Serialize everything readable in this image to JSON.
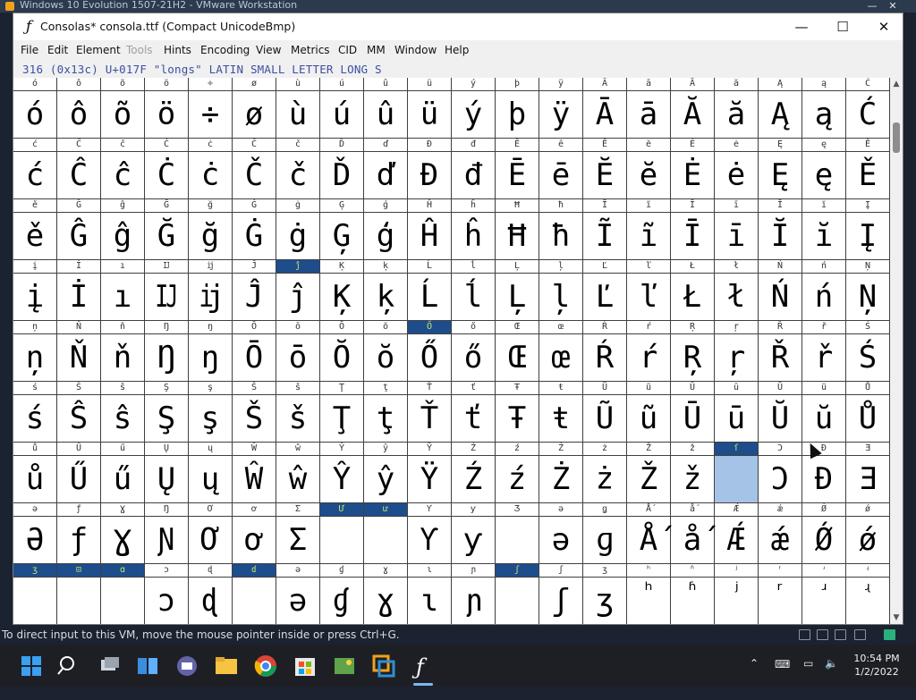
{
  "vm_window": {
    "title": "Windows 10 Evolution 1507-21H2 - VMware Workstation",
    "minimize": "—",
    "close": "✕"
  },
  "app": {
    "title": "Consolas* consola.ttf (Compact UnicodeBmp)",
    "icon": "fontforge-icon",
    "minimize": "—",
    "maximize": "☐",
    "close": "✕"
  },
  "menu": [
    {
      "label": "File",
      "enabled": true
    },
    {
      "label": "Edit",
      "enabled": true
    },
    {
      "label": "Element",
      "enabled": true
    },
    {
      "label": "Tools",
      "enabled": false
    },
    {
      "label": "Hints",
      "enabled": true
    },
    {
      "label": "Encoding",
      "enabled": true
    },
    {
      "label": "View",
      "enabled": true
    },
    {
      "label": "Metrics",
      "enabled": true
    },
    {
      "label": "CID",
      "enabled": true
    },
    {
      "label": "MM",
      "enabled": true
    },
    {
      "label": "Window",
      "enabled": true
    },
    {
      "label": "Help",
      "enabled": true
    }
  ],
  "info_line": "316 (0x13c) U+017F \"longs\" LATIN SMALL LETTER LONG S",
  "colors": {
    "highlight_label": "#1e4d8c",
    "highlight_text": "#c8e36a",
    "selected_cell": "#a5c3e6"
  },
  "grid": {
    "rows": [
      {
        "labels": [
          "ó",
          "ô",
          "õ",
          "ö",
          "÷",
          "ø",
          "ù",
          "ú",
          "û",
          "ü",
          "ý",
          "þ",
          "ÿ",
          "Ā",
          "ā",
          "Ă",
          "ă",
          "Ą",
          "ą",
          "Ć"
        ],
        "glyphs": [
          "ó",
          "ô",
          "õ",
          "ö",
          "÷",
          "ø",
          "ù",
          "ú",
          "û",
          "ü",
          "ý",
          "þ",
          "ÿ",
          "Ā",
          "ā",
          "Ă",
          "ă",
          "Ą",
          "ą",
          "Ć"
        ]
      },
      {
        "labels": [
          "ć",
          "Ĉ",
          "ĉ",
          "Ċ",
          "ċ",
          "Č",
          "č",
          "Ď",
          "ď",
          "Đ",
          "đ",
          "Ē",
          "ē",
          "Ĕ",
          "ĕ",
          "Ė",
          "ė",
          "Ę",
          "ę",
          "Ě"
        ],
        "glyphs": [
          "ć",
          "Ĉ",
          "ĉ",
          "Ċ",
          "ċ",
          "Č",
          "č",
          "Ď",
          "ď",
          "Đ",
          "đ",
          "Ē",
          "ē",
          "Ĕ",
          "ĕ",
          "Ė",
          "ė",
          "Ę",
          "ę",
          "Ě"
        ]
      },
      {
        "labels": [
          "ě",
          "Ĝ",
          "ĝ",
          "Ğ",
          "ğ",
          "Ġ",
          "ġ",
          "Ģ",
          "ģ",
          "Ĥ",
          "ĥ",
          "Ħ",
          "ħ",
          "Ĩ",
          "ĩ",
          "Ī",
          "ī",
          "Ĭ",
          "ĭ",
          "Į"
        ],
        "glyphs": [
          "ě",
          "Ĝ",
          "ĝ",
          "Ğ",
          "ğ",
          "Ġ",
          "ġ",
          "Ģ",
          "ģ",
          "Ĥ",
          "ĥ",
          "Ħ",
          "ħ",
          "Ĩ",
          "ĩ",
          "Ī",
          "ī",
          "Ĭ",
          "ĭ",
          "Į"
        ]
      },
      {
        "labels": [
          "į",
          "İ",
          "ı",
          "Ĳ",
          "ĳ",
          "Ĵ",
          "ĵ",
          "Ķ",
          "ķ",
          "Ĺ",
          "ĺ",
          "Ļ",
          "ļ",
          "Ľ",
          "ľ",
          "Ł",
          "ł",
          "Ń",
          "ń",
          "Ņ"
        ],
        "glyphs": [
          "į",
          "İ",
          "ı",
          "Ĳ",
          "ĳ",
          "Ĵ",
          "ĵ",
          "Ķ",
          "ķ",
          "Ĺ",
          "ĺ",
          "Ļ",
          "ļ",
          "Ľ",
          "ľ",
          "Ł",
          "ł",
          "Ń",
          "ń",
          "Ņ"
        ],
        "hl": [
          6
        ]
      },
      {
        "labels": [
          "ņ",
          "Ň",
          "ň",
          "Ŋ",
          "ŋ",
          "Ō",
          "ō",
          "Ŏ",
          "ŏ",
          "Ő",
          "ő",
          "Œ",
          "œ",
          "Ŕ",
          "ŕ",
          "Ŗ",
          "ŗ",
          "Ř",
          "ř",
          "Ś"
        ],
        "glyphs": [
          "ņ",
          "Ň",
          "ň",
          "Ŋ",
          "ŋ",
          "Ō",
          "ō",
          "Ŏ",
          "ŏ",
          "Ő",
          "ő",
          "Œ",
          "œ",
          "Ŕ",
          "ŕ",
          "Ŗ",
          "ŗ",
          "Ř",
          "ř",
          "Ś"
        ],
        "hl": [
          9
        ]
      },
      {
        "labels": [
          "ś",
          "Ŝ",
          "ŝ",
          "Ş",
          "ş",
          "Š",
          "š",
          "Ţ",
          "ţ",
          "Ť",
          "ť",
          "Ŧ",
          "ŧ",
          "Ũ",
          "ũ",
          "Ū",
          "ū",
          "Ŭ",
          "ŭ",
          "Ů"
        ],
        "glyphs": [
          "ś",
          "Ŝ",
          "ŝ",
          "Ş",
          "ş",
          "Š",
          "š",
          "Ţ",
          "ţ",
          "Ť",
          "ť",
          "Ŧ",
          "ŧ",
          "Ũ",
          "ũ",
          "Ū",
          "ū",
          "Ŭ",
          "ŭ",
          "Ů"
        ]
      },
      {
        "labels": [
          "ů",
          "Ű",
          "ű",
          "Ų",
          "ų",
          "Ŵ",
          "ŵ",
          "Ŷ",
          "ŷ",
          "Ÿ",
          "Ź",
          "ź",
          "Ż",
          "ż",
          "Ž",
          "ž",
          "ſ",
          "Ɔ",
          "Ɖ",
          "Ǝ"
        ],
        "glyphs": [
          "ů",
          "Ű",
          "ű",
          "Ų",
          "ų",
          "Ŵ",
          "ŵ",
          "Ŷ",
          "ŷ",
          "Ÿ",
          "Ź",
          "ź",
          "Ż",
          "ż",
          "Ž",
          "ž",
          "",
          "Ɔ",
          "Đ",
          "Ǝ"
        ],
        "hl": [
          16
        ],
        "sel": [
          16
        ]
      },
      {
        "labels": [
          "ə",
          "ƒ",
          "Ɣ",
          "Ŋ",
          "Ơ",
          "ơ",
          "Ʃ",
          "Ư",
          "ư",
          "Ƴ",
          "ƴ",
          "Ʒ",
          "ǝ",
          "ǥ",
          "Ǻ",
          "ǻ",
          "Ǽ",
          "ǽ",
          "Ǿ",
          "ǿ"
        ],
        "glyphs": [
          "Ə",
          "ƒ",
          "Ɣ",
          "Ɲ",
          "Ơ",
          "ơ",
          "Ʃ",
          "",
          "",
          "Ƴ",
          "ƴ",
          "",
          "ə",
          "ɡ",
          "Ǻ",
          "ǻ",
          "Ǽ",
          "ǽ",
          "Ǿ",
          "ǿ"
        ],
        "hl": [
          7,
          8
        ]
      },
      {
        "labels": [
          "ʒ",
          "⊡",
          "ɑ",
          "ɔ",
          "ɖ",
          "ɗ",
          "ə",
          "ɠ",
          "ɣ",
          "ɩ",
          "ɲ",
          "ʃ",
          "ʃ",
          "ʒ",
          "ʰ",
          "ʱ",
          "ʲ",
          "ʳ",
          "ʴ",
          "ʵ"
        ],
        "glyphs": [
          "",
          "",
          "",
          "ɔ",
          "ɖ",
          "",
          "ə",
          "ɠ",
          "ɣ",
          "ɩ",
          "ɲ",
          "",
          "ʃ",
          "ʒ",
          "ʰ",
          "ʱ",
          "ʲ",
          "ʳ",
          "ʴ",
          "ʵ"
        ],
        "hl": [
          0,
          1,
          2,
          5,
          11
        ],
        "small": [
          14,
          15,
          16,
          17,
          18,
          19
        ]
      }
    ]
  },
  "vm_status": {
    "message": "To direct input to this VM, move the mouse pointer inside or press Ctrl+G."
  },
  "taskbar": {
    "apps": [
      "windows-start",
      "search",
      "task-view",
      "widgets",
      "teams",
      "file-explorer",
      "chrome",
      "store",
      "photos",
      "vmware",
      "fontforge"
    ],
    "time": "10:54 PM",
    "date": "1/2/2022"
  }
}
